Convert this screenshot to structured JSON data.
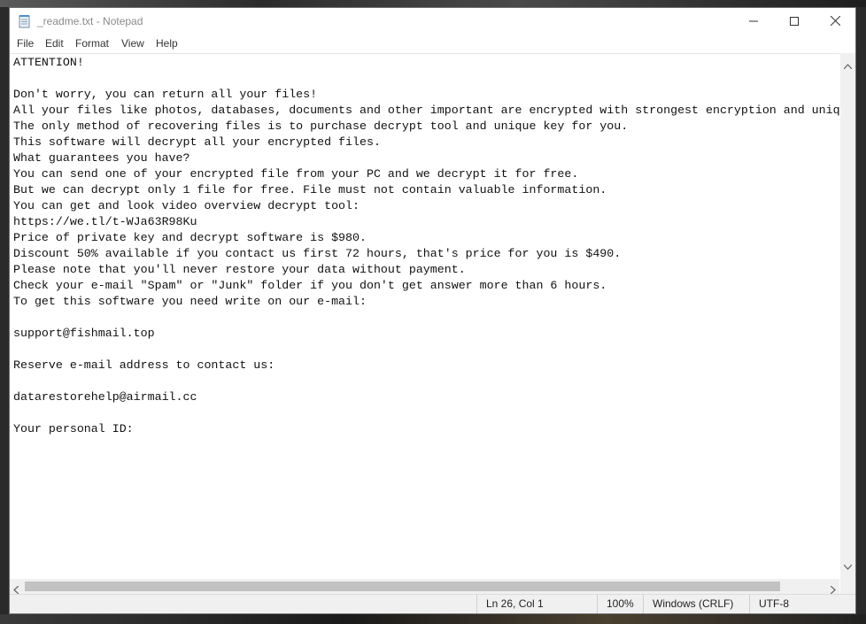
{
  "window": {
    "title": "_readme.txt - Notepad"
  },
  "icons": {
    "app": "notepad-icon",
    "minimize": "minimize-icon",
    "maximize": "maximize-icon",
    "close": "close-icon"
  },
  "menu": {
    "file": "File",
    "edit": "Edit",
    "format": "Format",
    "view": "View",
    "help": "Help"
  },
  "document": {
    "lines": [
      "ATTENTION!",
      "",
      "Don't worry, you can return all your files!",
      "All your files like photos, databases, documents and other important are encrypted with strongest encryption and uniq",
      "The only method of recovering files is to purchase decrypt tool and unique key for you.",
      "This software will decrypt all your encrypted files.",
      "What guarantees you have?",
      "You can send one of your encrypted file from your PC and we decrypt it for free.",
      "But we can decrypt only 1 file for free. File must not contain valuable information.",
      "You can get and look video overview decrypt tool:",
      "https://we.tl/t-WJa63R98Ku",
      "Price of private key and decrypt software is $980.",
      "Discount 50% available if you contact us first 72 hours, that's price for you is $490.",
      "Please note that you'll never restore your data without payment.",
      "Check your e-mail \"Spam\" or \"Junk\" folder if you don't get answer more than 6 hours.",
      "To get this software you need write on our e-mail:",
      "",
      "support@fishmail.top",
      "",
      "Reserve e-mail address to contact us:",
      "",
      "datarestorehelp@airmail.cc",
      "",
      "Your personal ID:"
    ]
  },
  "status": {
    "position": "Ln 26, Col 1",
    "zoom": "100%",
    "line_ending": "Windows (CRLF)",
    "encoding": "UTF-8"
  }
}
